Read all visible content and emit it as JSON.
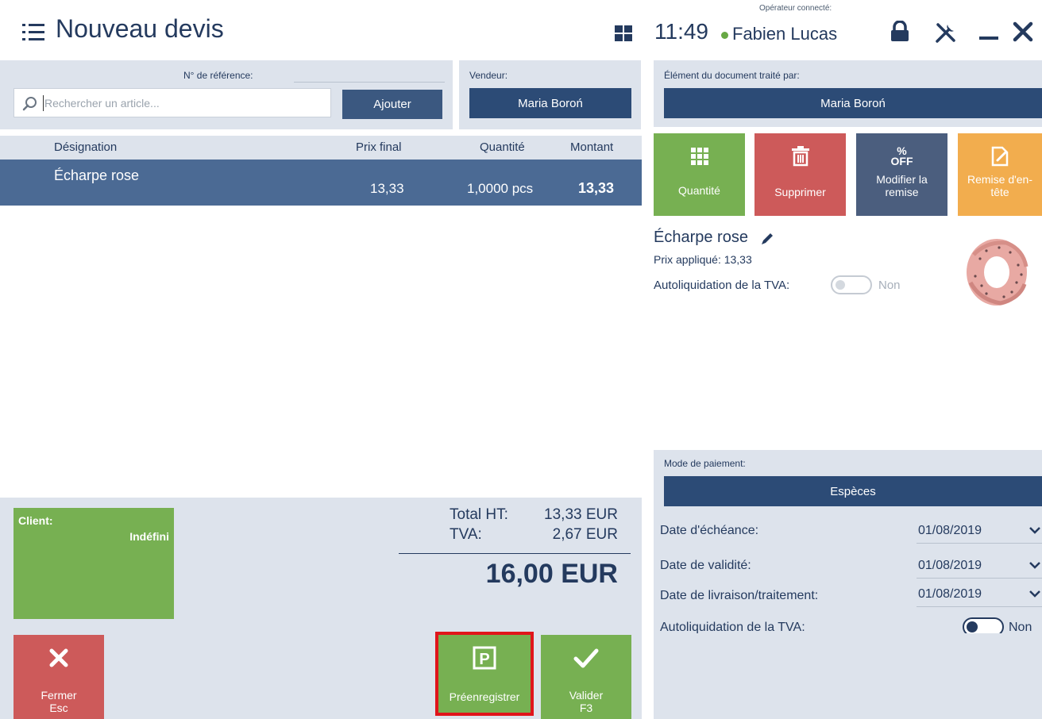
{
  "header": {
    "title": "Nouveau devis",
    "time": "11:49",
    "operator_caption": "Opérateur connecté:",
    "operator_name": "Fabien Lucas"
  },
  "reference": {
    "label": "N° de référence:",
    "search_placeholder": "Rechercher un article...",
    "add_button": "Ajouter"
  },
  "vendeur": {
    "label": "Vendeur:",
    "value": "Maria Boroń"
  },
  "table": {
    "columns": [
      "Désignation",
      "Prix final",
      "Quantité",
      "Montant"
    ],
    "rows": [
      {
        "designation": "Écharpe rose",
        "prix_final": "13,33",
        "quantite": "1,0000 pcs",
        "montant": "13,33"
      }
    ]
  },
  "client": {
    "label": "Client:",
    "value": "Indéfini"
  },
  "totals": {
    "ht_label": "Total HT:",
    "ht_value": "13,33 EUR",
    "tva_label": "TVA:",
    "tva_value": "2,67 EUR",
    "total": "16,00 EUR"
  },
  "bottom_buttons": {
    "fermer": "Fermer",
    "fermer_key": "Esc",
    "preenregistrer": "Préenregistrer",
    "valider": "Valider",
    "valider_key": "F3"
  },
  "right": {
    "traite_label": "Élément du document traité par:",
    "traite_value": "Maria Boroń",
    "actions": {
      "quantite": "Quantité",
      "supprimer": "Supprimer",
      "modifier_remise_1": "Modifier la",
      "modifier_remise_2": "remise",
      "remise_entete_1": "Remise d'en-",
      "remise_entete_2": "tête",
      "off_pct": "%",
      "off_text": "OFF"
    },
    "item": {
      "name": "Écharpe rose",
      "prix_label": "Prix appliqué: 13,33",
      "autoliq_label": "Autoliquidation de la TVA:",
      "autoliq_value": "Non"
    },
    "paiement": {
      "label": "Mode de paiement:",
      "value": "Espèces",
      "echeance_label": "Date d'échéance:",
      "echeance_value": "01/08/2019",
      "validite_label": "Date de validité:",
      "validite_value": "01/08/2019",
      "livraison_label": "Date de livraison/traitement:",
      "livraison_value": "01/08/2019",
      "autoliq_label": "Autoliquidation de la TVA:",
      "autoliq_value": "Non"
    }
  },
  "colors": {
    "navy": "#2c4b76",
    "green": "#77b052",
    "red": "#cd5a5a",
    "slate": "#4b6a94",
    "orange": "#f2ad4e",
    "highlight": "#e0151b"
  }
}
